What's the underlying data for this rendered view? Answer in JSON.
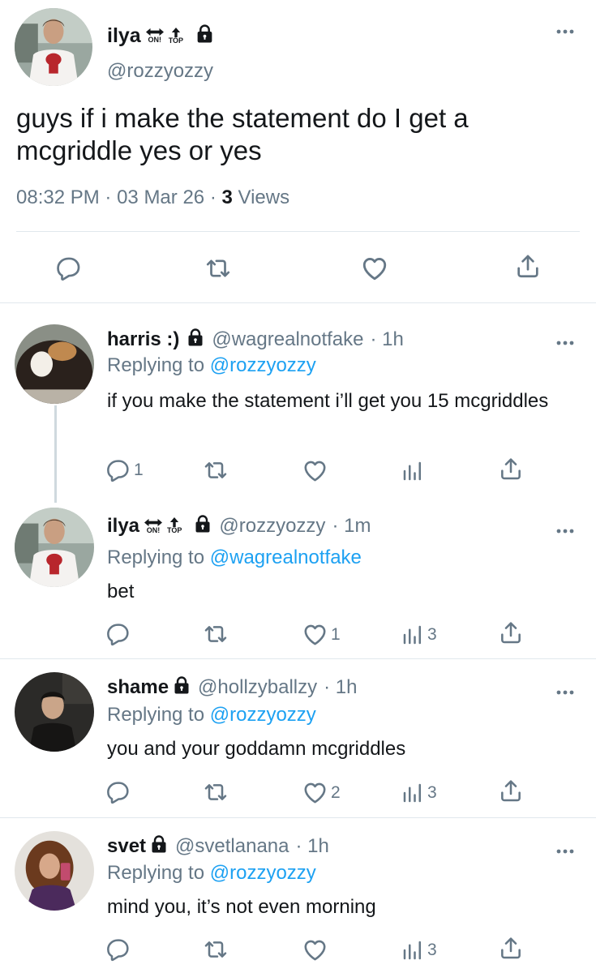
{
  "main_tweet": {
    "name": "ilya",
    "badge_on": "ON!",
    "badge_top": "TOP",
    "handle": "@rozzyozzy",
    "text": "guys if i make the statement do I get a mcgriddle yes or yes",
    "time": "08:32 PM",
    "separator": "·",
    "date": "03 Mar 26",
    "views_count": "3",
    "views_label": "Views"
  },
  "replies": [
    {
      "name": "harris :)",
      "handle": "@wagrealnotfake",
      "time": "· 1h",
      "replying_prefix": "Replying to",
      "replying_to": "@rozzyozzy",
      "text": "if you make the statement i’ll get you 15 mcgriddles",
      "reply_count": "1",
      "like_count": "",
      "views_count": ""
    },
    {
      "name": "ilya",
      "badge_on": "ON!",
      "badge_top": "TOP",
      "handle": "@rozzyozzy",
      "time": "· 1m",
      "replying_prefix": "Replying to",
      "replying_to": "@wagrealnotfake",
      "text": "bet",
      "reply_count": "",
      "like_count": "1",
      "views_count": "3"
    },
    {
      "name": "shame",
      "handle": "@hollzyballzy",
      "time": "· 1h",
      "replying_prefix": "Replying to",
      "replying_to": "@rozzyozzy",
      "text": "you and your goddamn mcgriddles",
      "reply_count": "",
      "like_count": "2",
      "views_count": "3"
    },
    {
      "name": "svet",
      "handle": "@svetlanana",
      "time": "· 1h",
      "replying_prefix": "Replying to",
      "replying_to": "@rozzyozzy",
      "text": "mind you, it’s not even morning",
      "reply_count": "",
      "like_count": "",
      "views_count": "3"
    }
  ],
  "icons": {
    "reply": "reply-icon",
    "retweet": "retweet-icon",
    "like": "heart-icon",
    "views": "views-icon",
    "share": "share-icon",
    "more": "more-icon",
    "lock": "lock-icon"
  },
  "colors": {
    "text": "#14171a",
    "secondary": "#657786",
    "link": "#1da1f2",
    "divider": "#e1e8ed"
  }
}
